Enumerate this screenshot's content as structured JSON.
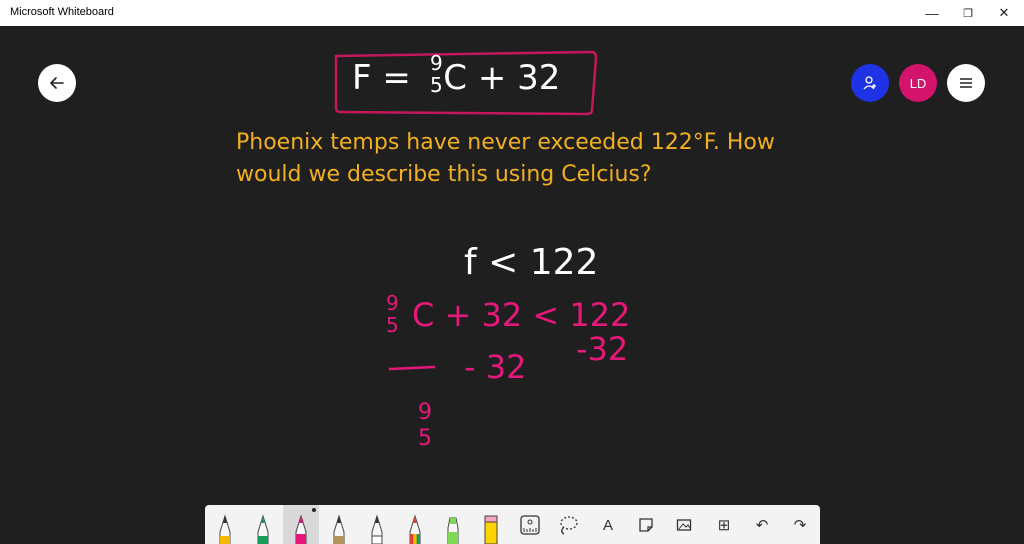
{
  "window": {
    "title": "Microsoft Whiteboard",
    "minimize_glyph": "—",
    "restore_glyph": "❐",
    "close_glyph": "✕"
  },
  "canvas": {
    "formula": "F  =    C  +  32",
    "formula_frac_num": "9",
    "formula_frac_den": "5",
    "question_line1": "Phoenix temps have never exceeded 122°F. How",
    "question_line2": "would we describe this using Celcius?",
    "step1": "f < 122",
    "step2_frac_num": "9",
    "step2_frac_den": "5",
    "step2_rest": "C + 32  <  122",
    "step3_left": "- 32",
    "step3_right": "-32",
    "step4_frac_num": "9",
    "step4_frac_den": "5"
  },
  "header_buttons": {
    "avatar_initials": "LD"
  },
  "colors": {
    "canvas_bg": "#1f1f1f",
    "formula_box": "#c2185b",
    "question_text": "#f2b01e",
    "pink_ink": "#e6197a",
    "white_ink": "#ffffff",
    "invite_btn": "#1e33e6",
    "avatar_btn": "#d4136d"
  },
  "toolbar": {
    "tools": [
      {
        "name": "pen-yellow",
        "color": "#f5b800"
      },
      {
        "name": "pen-green",
        "color": "#1a9c5b"
      },
      {
        "name": "pen-magenta",
        "color": "#e6197a"
      },
      {
        "name": "pen-tan",
        "color": "#b0945a"
      },
      {
        "name": "pen-white",
        "color": "#ffffff"
      },
      {
        "name": "pen-rainbow",
        "color": "#e2403b"
      },
      {
        "name": "highlighter-green",
        "color": "#7ed957"
      },
      {
        "name": "highlighter-yellow",
        "color": "#ffd400"
      }
    ],
    "text_glyph": "A",
    "add_glyph": "⊞",
    "undo_glyph": "↶",
    "redo_glyph": "↷"
  }
}
